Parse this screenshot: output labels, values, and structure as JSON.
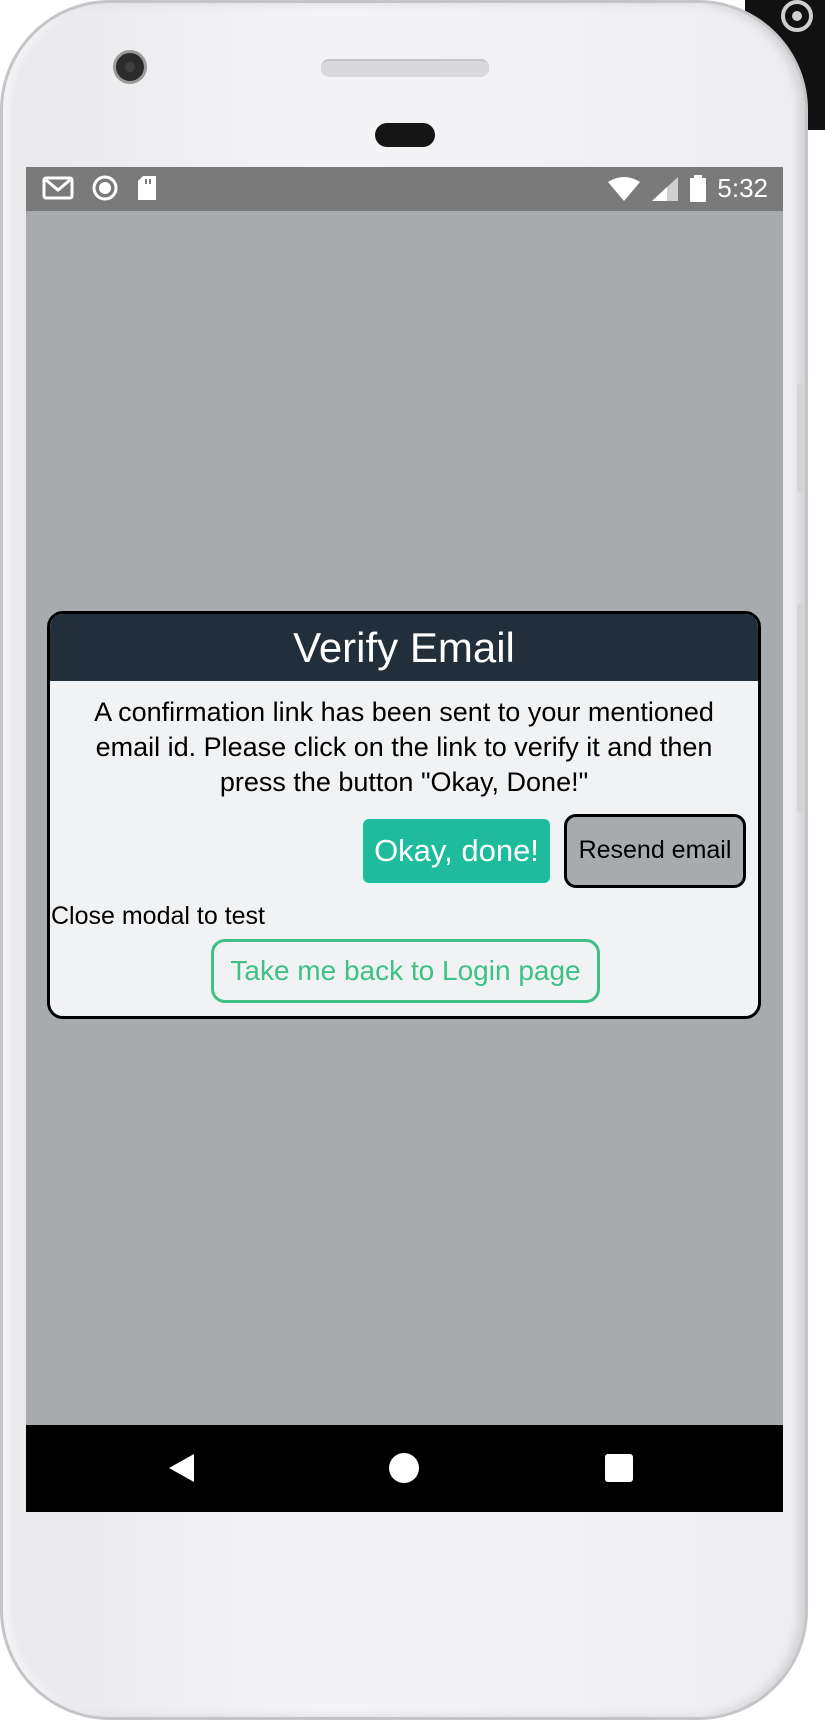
{
  "status_bar": {
    "time": "5:32",
    "icons_left": [
      "gmail-icon",
      "circle-icon",
      "sd-card-icon"
    ],
    "icons_right": [
      "wifi-icon",
      "signal-icon",
      "battery-icon"
    ]
  },
  "modal": {
    "title": "Verify Email",
    "message": "A confirmation link has been sent to your mentioned email id. Please click on the link to verify it and then press the button \"Okay, Done!\"",
    "ok_button": "Okay, done!",
    "resend_button": "Resend email",
    "close_text": "Close modal to test",
    "back_button": "Take me back to Login page"
  },
  "nav_bar": {
    "icons": [
      "back-icon",
      "home-icon",
      "recents-icon"
    ]
  },
  "colors": {
    "header_bg": "#222e3a",
    "ok_button": "#1ebc9c",
    "back_button_accent": "#3ec086",
    "overlay": "#a7abae"
  }
}
